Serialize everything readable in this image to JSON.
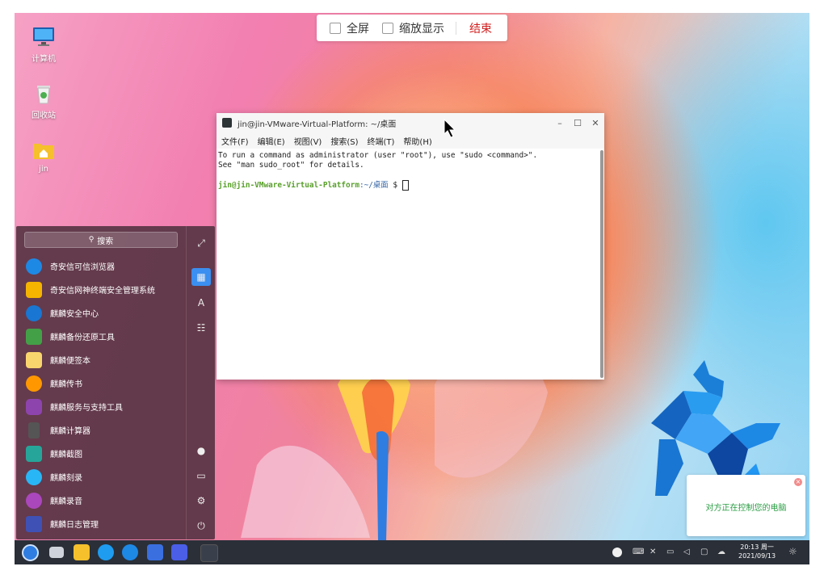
{
  "desktop": {
    "icons": [
      {
        "label": "计算机"
      },
      {
        "label": "回收站"
      },
      {
        "label": "jin"
      }
    ]
  },
  "remote_bar": {
    "fullscreen_label": "全屏",
    "scale_label": "缩放显示",
    "end_label": "结束"
  },
  "terminal": {
    "title": "jin@jin-VMware-Virtual-Platform: ~/桌面",
    "menu": [
      "文件(F)",
      "编辑(E)",
      "视图(V)",
      "搜索(S)",
      "终端(T)",
      "帮助(H)"
    ],
    "lines": [
      "To run a command as administrator (user \"root\"), use \"sudo <command>\".",
      "See \"man sudo_root\" for details."
    ],
    "prompt_user": "jin@jin-VMware-Virtual-Platform",
    "prompt_path": ":~/桌面",
    "prompt_symbol": "$"
  },
  "start_menu": {
    "search_placeholder": "搜索",
    "apps": [
      {
        "label": "奇安信可信浏览器",
        "color": "#1e88e5"
      },
      {
        "label": "奇安信网神终端安全管理系统",
        "color": "#f4b400"
      },
      {
        "label": "麒麟安全中心",
        "color": "#1976d2"
      },
      {
        "label": "麒麟备份还原工具",
        "color": "#43a047"
      },
      {
        "label": "麒麟便签本",
        "color": "#f9d56e"
      },
      {
        "label": "麒麟传书",
        "color": "#ff9800"
      },
      {
        "label": "麒麟服务与支持工具",
        "color": "#8e44ad"
      },
      {
        "label": "麒麟计算器",
        "color": "#555555"
      },
      {
        "label": "麒麟截图",
        "color": "#26a69a"
      },
      {
        "label": "麒麟刻录",
        "color": "#29b6f6"
      },
      {
        "label": "麒麟录音",
        "color": "#ab47bc"
      },
      {
        "label": "麒麟日志管理",
        "color": "#3f51b5"
      }
    ]
  },
  "taskbar": {
    "time": "20:13 周一",
    "date": "2021/09/13"
  },
  "notification": {
    "message": "对方正在控制您的电脑"
  }
}
